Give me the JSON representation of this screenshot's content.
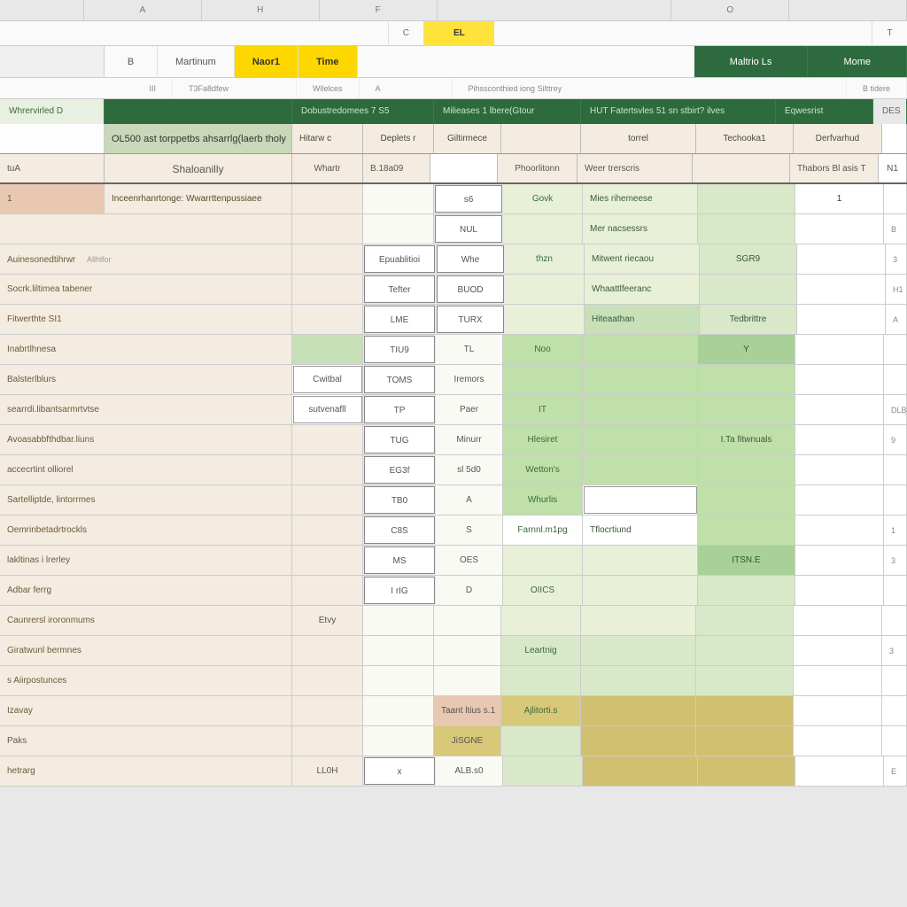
{
  "colheaders": [
    "A",
    "H",
    "F",
    "",
    "O",
    ""
  ],
  "secondary": {
    "c": "C",
    "tab1": "EL",
    "tab2": "T"
  },
  "ribbon": {
    "b": "B",
    "name1": "Martinum",
    "name2": "Naor1",
    "name3": "Time",
    "right1": "Maltrio Ls",
    "right2": "Mome"
  },
  "subribbon": {
    "s1": "III",
    "s2": "T3Fa8dfew",
    "s3": "Wilelces",
    "s4": "A",
    "s5": "Pihssconthied iong Silttrey",
    "s6": "B tidere"
  },
  "greenband": {
    "g1": "Whrervirled    D",
    "g2": "",
    "g3": "Dobustredomees  7 S5",
    "g4": "Milieases 1  lbere(Gtour",
    "g5": "HUT Fatertsvles 51 sn stbirt? ilves",
    "g6": "Eqwesrist",
    "gend": "DES"
  },
  "coltitles": {
    "t1": "",
    "t2": "OL500 ast torppetbs ahsarrlg(laerb tholy",
    "t3": "Hitarw c",
    "t4": "Deplets r",
    "t5": "Giltirmece",
    "t6": "torrel",
    "t7": "Techooka1",
    "t8": "Derfvarhud"
  },
  "coltitles2": {
    "t1": "tuA",
    "t2": "Shaloanilly",
    "t3": "Whartr",
    "t4": "B.18a09",
    "t5": "",
    "t6": "Phoorlitonn",
    "t7": "Weer trerscris",
    "t8": "",
    "t9": "Thabors Bl asis T",
    "tend": "N1"
  },
  "rows": [
    {
      "c1": "1",
      "c2": "Inceenrhanrtonge: Wwarrttenpussiaee",
      "c3": "",
      "c4": "",
      "c5": "s6",
      "c6": "Govk",
      "c7": "Mies rihemeese",
      "c8": "",
      "c9": "1",
      "cend": ""
    },
    {
      "c1": "",
      "c2": "",
      "c3": "",
      "c4": "",
      "c5": "NUL",
      "c6": "",
      "c7": "Mer nacsessrs",
      "c8": "",
      "c9": "",
      "cend": "B"
    },
    {
      "c1": "Auinesonedtihrwr",
      "c2b": "Allhlfor",
      "c3": "",
      "c4": "Epuablitioi",
      "c5": "Whe",
      "c6": "thzn",
      "c7": "Mitwent riecaou",
      "c8": "SGR9",
      "c9": "",
      "cend": "3"
    },
    {
      "c1": "Socrk.liltimea tabener",
      "c2": "",
      "c3": "",
      "c4": "Tefter",
      "c5": "BUOD",
      "c6": "",
      "c7": "Whaattlfeeranc",
      "c8": "",
      "c9": "",
      "cend": "H1"
    },
    {
      "c1": "Fitwerthte   SI1",
      "c2": "",
      "c3": "",
      "c4": "LME",
      "c5": "TURX",
      "c6": "",
      "c7": "Hiteaathan",
      "c8": "Tedbrittre",
      "c9": "",
      "cend": "A"
    },
    {
      "c1": "Inabrtlhnesa",
      "c2": "",
      "c3": "",
      "c4": "TIU9",
      "c5": "TL",
      "c6": "Noo",
      "c7": "",
      "c8": "Y",
      "c9": "",
      "cend": ""
    },
    {
      "c1": "Balsterlblurs",
      "c2": "",
      "c3": "Cwitbal",
      "c4": "TOMS",
      "c5": "Iremors",
      "c6": "",
      "c7": "",
      "c8": "",
      "c9": "",
      "cend": ""
    },
    {
      "c1": "searrdi.libantsarmrtvtse",
      "c2": "",
      "c3": "sutvenafll",
      "c4": "TP",
      "c5": "Paer",
      "c6": "IT",
      "c7": "",
      "c8": "",
      "c9": "",
      "cend": "DLB"
    },
    {
      "c1": "Avoasabbfthdbar.liuns",
      "c2": "",
      "c3": "",
      "c4": "TUG",
      "c5": "Minurr",
      "c6": "Hlesiret",
      "c7": "",
      "c8": "I.Ta fitwnuals",
      "c9": "",
      "cend": "9"
    },
    {
      "c1": "accecrtint olliorel",
      "c2": "",
      "c3": "",
      "c4": "EG3f",
      "c5": "sl 5d0",
      "c6": "Wetton's",
      "c7": "",
      "c8": "",
      "c9": "",
      "cend": ""
    },
    {
      "c1": "Sartelliptde, lintorrmes",
      "c2": "",
      "c3": "",
      "c4": "TB0",
      "c5": "A",
      "c6": "Whurlis",
      "c7": "",
      "c8": "",
      "c9": "",
      "cend": ""
    },
    {
      "c1": "Oemrinbetadrtrockls",
      "c2": "",
      "c3": "",
      "c4": "C8S",
      "c5": "S",
      "c6": "Farnnl.m1pg",
      "c7": "Tflocrtiund",
      "c8": "",
      "c9": "",
      "cend": "1"
    },
    {
      "c1": "lakltinas  i lrerley",
      "c2": "",
      "c3": "",
      "c4": "MS",
      "c5": "OES",
      "c6": "",
      "c7": "",
      "c8": "ITSN.E",
      "c9": "",
      "cend": "3"
    },
    {
      "c1": "Adbar ferrg",
      "c2": "",
      "c3": "",
      "c4": "I rIG",
      "c5": "D",
      "c6": "OIICS",
      "c7": "",
      "c8": "",
      "c9": "",
      "cend": ""
    },
    {
      "c1": "Caunrersl iroronmums",
      "c2": "",
      "c3": "Etvy",
      "c4": "",
      "c5": "",
      "c6": "",
      "c7": "",
      "c8": "",
      "c9": "",
      "cend": ""
    },
    {
      "c1": "Giratwunl bermnes",
      "c2": "",
      "c3": "",
      "c4": "",
      "c5": "",
      "c6": "Leartnig",
      "c7": "",
      "c8": "",
      "c9": "",
      "cend": "3"
    },
    {
      "c1": "s Aiirpostunces",
      "c2": "",
      "c3": "",
      "c4": "",
      "c5": "",
      "c6": "",
      "c7": "",
      "c8": "",
      "c9": "",
      "cend": ""
    },
    {
      "c1": "Izavay",
      "c2": "",
      "c3": "",
      "c4": "",
      "c5": "Taant ltius s.1",
      "c6": "Ajlitorti.s",
      "c7": "",
      "c8": "",
      "c9": "",
      "cend": ""
    },
    {
      "c1": "Paks",
      "c2": "",
      "c3": "",
      "c4": "",
      "c5": "JiSGNE",
      "c6": "",
      "c7": "",
      "c8": "",
      "c9": "",
      "cend": ""
    },
    {
      "c1": "hetrarg",
      "c2": "",
      "c3": "LL0H",
      "c4": "x",
      "c5": "ALB.s0",
      "c6": "",
      "c7": "",
      "c8": "",
      "c9": "",
      "cend": "E"
    }
  ]
}
